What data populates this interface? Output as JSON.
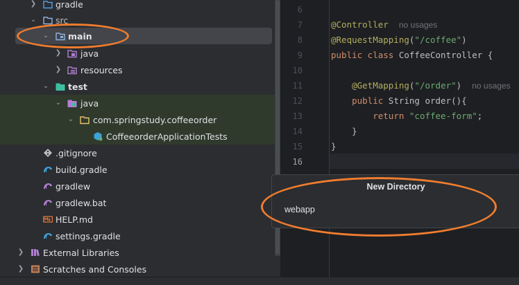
{
  "project_tree": {
    "items": [
      {
        "label": "gradle",
        "icon": "folder-icon",
        "icon_color": "#4d9ee3",
        "expanded": false
      },
      {
        "label": "src",
        "icon": "source-folder-icon",
        "icon_color": "#8bb2e0",
        "expanded": true
      },
      {
        "label": "main",
        "icon": "module-folder-icon",
        "icon_color": "#8bb2e0",
        "expanded": true,
        "selected": true
      },
      {
        "label": "java",
        "icon": "java-source-folder-icon",
        "icon_color": "#b17ed2",
        "expanded": false
      },
      {
        "label": "resources",
        "icon": "resources-folder-icon",
        "icon_color": "#b17ed2",
        "expanded": false
      },
      {
        "label": "test",
        "icon": "test-folder-icon",
        "icon_color": "#3cbfa0",
        "expanded": true
      },
      {
        "label": "java",
        "icon": "java-test-folder-icon",
        "icon_color": "#b17ed2",
        "expanded": true
      },
      {
        "label": "com.springstudy.coffeeorder",
        "icon": "package-folder-icon",
        "icon_color": "#e8c36c",
        "expanded": true
      },
      {
        "label": "CoffeeorderApplicationTests",
        "icon": "java-class-icon",
        "icon_color": "#3ea2d8"
      },
      {
        "label": ".gitignore",
        "icon": "git-icon",
        "icon_color": "#bcbec4"
      },
      {
        "label": "build.gradle",
        "icon": "gradle-elephant-icon",
        "icon_color": "#3ea2d8"
      },
      {
        "label": "gradlew",
        "icon": "gradle-elephant-icon",
        "icon_color": "#b17ed2"
      },
      {
        "label": "gradlew.bat",
        "icon": "gradle-elephant-icon",
        "icon_color": "#b17ed2"
      },
      {
        "label": "HELP.md",
        "icon": "markdown-icon",
        "icon_color": "#e87a3d"
      },
      {
        "label": "settings.gradle",
        "icon": "gradle-elephant-icon",
        "icon_color": "#3ea2d8"
      },
      {
        "label": "External Libraries",
        "icon": "libraries-icon",
        "icon_color": "#b17ed2",
        "expanded": false
      },
      {
        "label": "Scratches and Consoles",
        "icon": "scratches-icon",
        "icon_color": "#c4805a",
        "expanded": false
      }
    ]
  },
  "editor": {
    "line_numbers": [
      "6",
      "7",
      "8",
      "9",
      "10",
      "11",
      "12",
      "13",
      "14",
      "15",
      "16"
    ],
    "lines": {
      "l7_ann": "@Controller",
      "l7_hint": "no usages",
      "l8_ann": "@RequestMapping",
      "l8_rest": "(",
      "l8_str": "\"/coffee\"",
      "l8_close": ")",
      "l9_kw": "public class ",
      "l9_rest": "CoffeeController {",
      "l11_ann": "@GetMapping",
      "l11_open": "(",
      "l11_str": "\"/order\"",
      "l11_close": ")",
      "l11_hint": "no usages",
      "l12_kw": "public ",
      "l12_rest": "String order(){",
      "l13_kw": "return ",
      "l13_str": "\"coffee-form\"",
      "l13_end": ";",
      "l14": "}",
      "l15": "}"
    }
  },
  "new_directory_popup": {
    "title": "New Directory",
    "input_value": "webapp"
  },
  "annotation_color": "#f07d2f"
}
